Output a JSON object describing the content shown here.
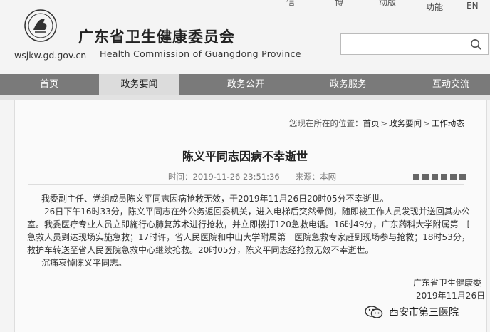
{
  "topbar": {
    "cut_items": [
      "信",
      "博",
      "动版"
    ],
    "accessibility": "功能",
    "lang": "EN"
  },
  "header": {
    "site_title": "广东省卫生健康委员会",
    "site_en": "Health Commission of Guangdong Province",
    "domain": "wsjkw.gd.gov.cn",
    "search_placeholder": ""
  },
  "nav": {
    "items": [
      "首页",
      "政务要闻",
      "政务公开",
      "政务服务",
      "互动交流"
    ],
    "active_index": 1
  },
  "breadcrumb": {
    "prefix": "您现在所在的位置：",
    "items": [
      "首页",
      "政务要闻",
      "工作动态"
    ],
    "sep": ">"
  },
  "article": {
    "title": "陈义平同志因病不幸逝世",
    "time_label": "时间：",
    "time": "2019-11-26 23:51:36",
    "source_label": "来源：",
    "source": "本网",
    "paragraphs": [
      "我委副主任、党组成员陈义平同志因病抢救无效，于2019年11月26日20时05分不幸逝世。",
      "26日下午16时33分，陈义平同志在外公务返回委机关，进入电梯后突然晕倒，随即被工作人员发现并送回其办公",
      "室。我委医疗专业人员立即施行心肺复苏术进行抢救，并立即拨打120急救电话。16时49分，广东药科大学附属第一医院",
      "急救人员到达现场实施急救；17时许，省人民医院和中山大学附属第一医院急救专家赶到现场参与抢救；18时53分，由",
      "救护车转送至省人民医院急救中心继续抢救。20时05分，陈义平同志经抢救无效不幸逝世。",
      "沉痛哀悼陈义平同志。"
    ],
    "signature_org": "广东省卫生健康委",
    "signature_date": "2019年11月26日"
  },
  "watermark": {
    "text": "西安市第三医院",
    "icon": "wechat-icon"
  }
}
